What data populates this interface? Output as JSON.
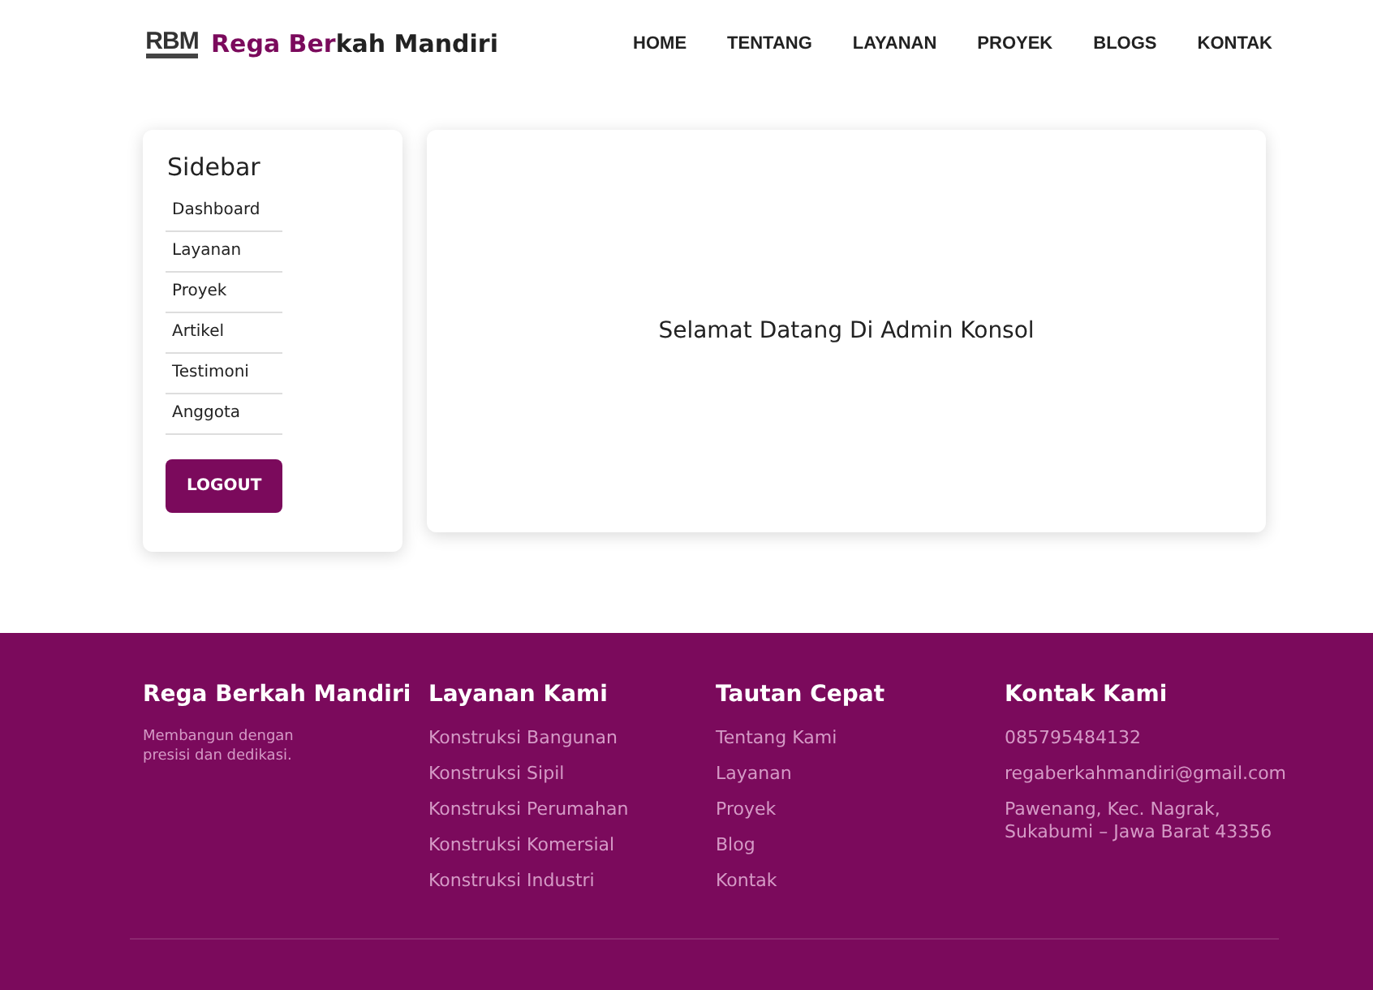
{
  "header": {
    "logo_text": "RBM",
    "brand_accent": "Rega Ber",
    "brand_rest": "kah Mandiri",
    "nav": [
      {
        "label": "HOME"
      },
      {
        "label": "TENTANG"
      },
      {
        "label": "LAYANAN"
      },
      {
        "label": "PROYEK"
      },
      {
        "label": "BLOGS"
      },
      {
        "label": "KONTAK"
      }
    ]
  },
  "sidebar": {
    "title": "Sidebar",
    "items": [
      "Dashboard",
      "Layanan",
      "Proyek",
      "Artikel",
      "Testimoni",
      "Anggota"
    ],
    "logout": "LOGOUT"
  },
  "main": {
    "message": "Selamat Datang Di Admin Konsol"
  },
  "footer": {
    "columns": [
      {
        "title": "Rega Berkah Mandiri",
        "kind": "text",
        "lines": [
          "Membangun dengan presisi dan dedikasi."
        ]
      },
      {
        "title": "Layanan Kami",
        "kind": "links",
        "lines": [
          "Konstruksi Bangunan",
          "Konstruksi Sipil",
          "Konstruksi Perumahan",
          "Konstruksi Komersial",
          "Konstruksi Industri"
        ]
      },
      {
        "title": "Tautan Cepat",
        "kind": "links",
        "lines": [
          "Tentang Kami",
          "Layanan",
          "Proyek",
          "Blog",
          "Kontak"
        ]
      },
      {
        "title": "Kontak Kami",
        "kind": "contact",
        "lines": [
          "085795484132",
          "regaberkahmandiri@gmail.com",
          "Pawenang, Kec. Nagrak, Sukabumi – Jawa Barat 43356"
        ]
      }
    ]
  }
}
